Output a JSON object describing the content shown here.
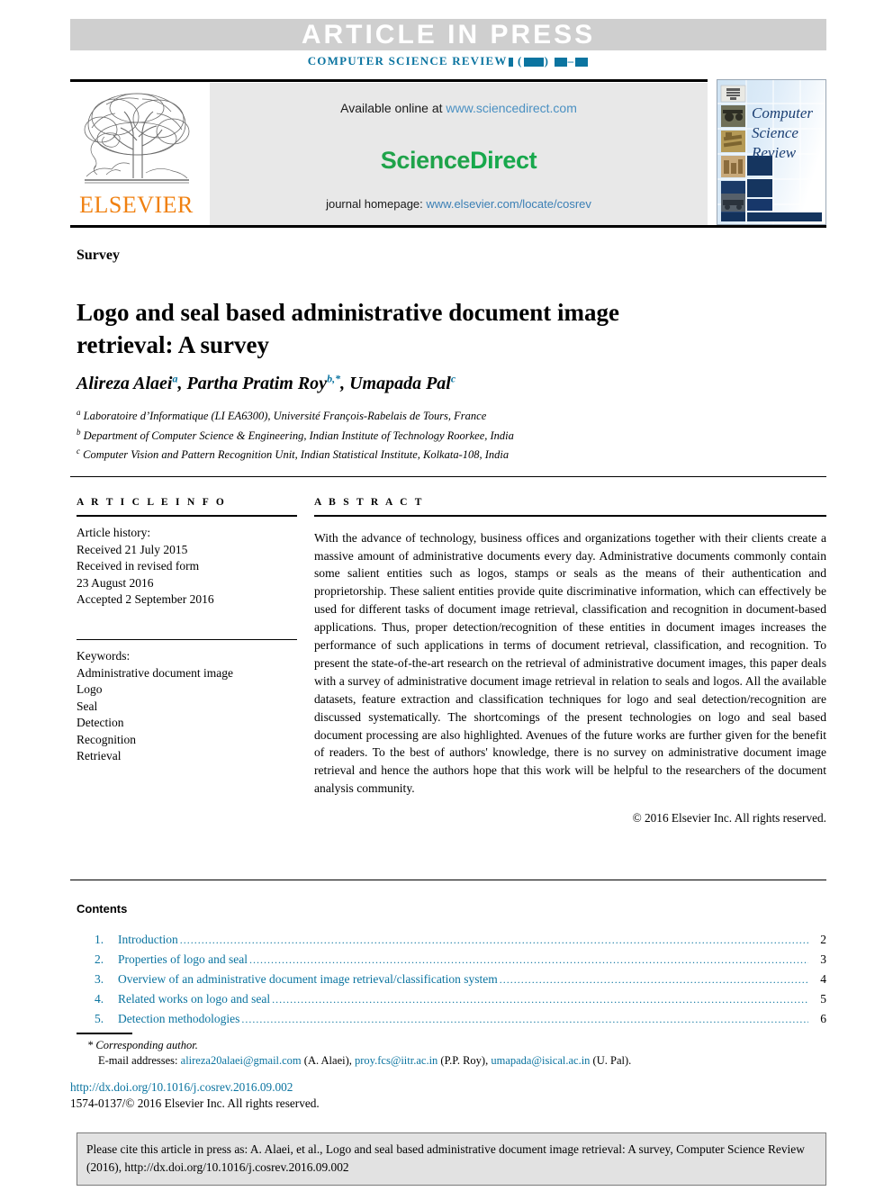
{
  "banner": {
    "article_in_press": "ARTICLE IN PRESS",
    "journal_running_head": "COMPUTER SCIENCE REVIEW",
    "volume_placeholder": "( )",
    "pages_placeholder": "–"
  },
  "masthead": {
    "publisher": "ELSEVIER",
    "available_prefix": "Available online at ",
    "available_url": "www.sciencedirect.com",
    "sciencedirect_part1": "Science",
    "sciencedirect_part2": "Direct",
    "homepage_prefix": "journal homepage: ",
    "homepage_url": "www.elsevier.com/locate/cosrev",
    "cover_line1": "Computer",
    "cover_line2": "Science",
    "cover_line3": "Review"
  },
  "article": {
    "type": "Survey",
    "title": "Logo and seal based administrative document image retrieval: A survey",
    "authors_html": "Alireza Alaei<sup>a</sup>, Partha Pratim Roy<sup>b,*</sup>, Umapada Pal<sup>c</sup>",
    "affiliations": [
      {
        "marker": "a",
        "text": "Laboratoire d’Informatique (LI EA6300), Université François-Rabelais de Tours, France"
      },
      {
        "marker": "b",
        "text": "Department of Computer Science & Engineering, Indian Institute of Technology Roorkee, India"
      },
      {
        "marker": "c",
        "text": "Computer Vision and Pattern Recognition Unit, Indian Statistical Institute, Kolkata-108, India"
      }
    ]
  },
  "article_info": {
    "heading": "A R T I C L E  I N F O",
    "history_label": "Article history:",
    "received": "Received 21 July 2015",
    "revised_label": "Received in revised form",
    "revised_date": "23 August 2016",
    "accepted": "Accepted 2 September 2016",
    "keywords_label": "Keywords:",
    "keywords": [
      "Administrative document image",
      "Logo",
      "Seal",
      "Detection",
      "Recognition",
      "Retrieval"
    ]
  },
  "abstract": {
    "heading": "A B S T R A C T",
    "text": "With the advance of technology, business offices and organizations together with their clients create a massive amount of administrative documents every day. Administrative documents commonly contain some salient entities such as logos, stamps or seals as the means of their authentication and proprietorship. These salient entities provide quite discriminative information, which can effectively be used for different tasks of document image retrieval, classification and recognition in document-based applications. Thus, proper detection/recognition of these entities in document images increases the performance of such applications in terms of document retrieval, classification, and recognition. To present the state-of-the-art research on the retrieval of administrative document images, this paper deals with a survey of administrative document image retrieval in relation to seals and logos. All the available datasets, feature extraction and classification techniques for logo and seal detection/recognition are discussed systematically. The shortcomings of the present technologies on logo and seal based document processing are also highlighted. Avenues of the future works are further given for the benefit of readers. To the best of authors' knowledge, there is no survey on administrative document image retrieval and hence the authors hope that this work will be helpful to the researchers of the document analysis community.",
    "copyright": "© 2016 Elsevier Inc. All rights reserved."
  },
  "contents": {
    "title": "Contents",
    "items": [
      {
        "number": "1.",
        "label": "Introduction",
        "page": "2"
      },
      {
        "number": "2.",
        "label": "Properties of logo and seal",
        "page": "3"
      },
      {
        "number": "3.",
        "label": "Overview of an administrative document image retrieval/classification system",
        "page": "4"
      },
      {
        "number": "4.",
        "label": "Related works on logo and seal",
        "page": "5"
      },
      {
        "number": "5.",
        "label": "Detection methodologies",
        "page": "6"
      }
    ],
    "dot_leader": "................................................................................................................................................................................................................"
  },
  "footer": {
    "corresponding": "* Corresponding author.",
    "emails_label": "E-mail addresses:",
    "emails": [
      {
        "address": "alireza20alaei@gmail.com",
        "name": "(A. Alaei),"
      },
      {
        "address": "proy.fcs@iitr.ac.in",
        "name": "(P.P. Roy),"
      },
      {
        "address": "umapada@isical.ac.in",
        "name": "(U. Pal)."
      }
    ],
    "doi": "http://dx.doi.org/10.1016/j.cosrev.2016.09.002",
    "issn_copyright": "1574-0137/© 2016 Elsevier Inc. All rights reserved."
  },
  "cite_box": {
    "text": "Please cite this article in press as: A. Alaei, et al., Logo and seal based administrative document image retrieval: A survey, Computer Science Review (2016), http://dx.doi.org/10.1016/j.cosrev.2016.09.002"
  },
  "colors": {
    "link": "#0b74a0",
    "elsevier_orange": "#f08010",
    "sciencedirect_green": "#1fa34a",
    "banner_gray": "#cfcfcf",
    "cite_box_gray": "#e2e2e2"
  }
}
